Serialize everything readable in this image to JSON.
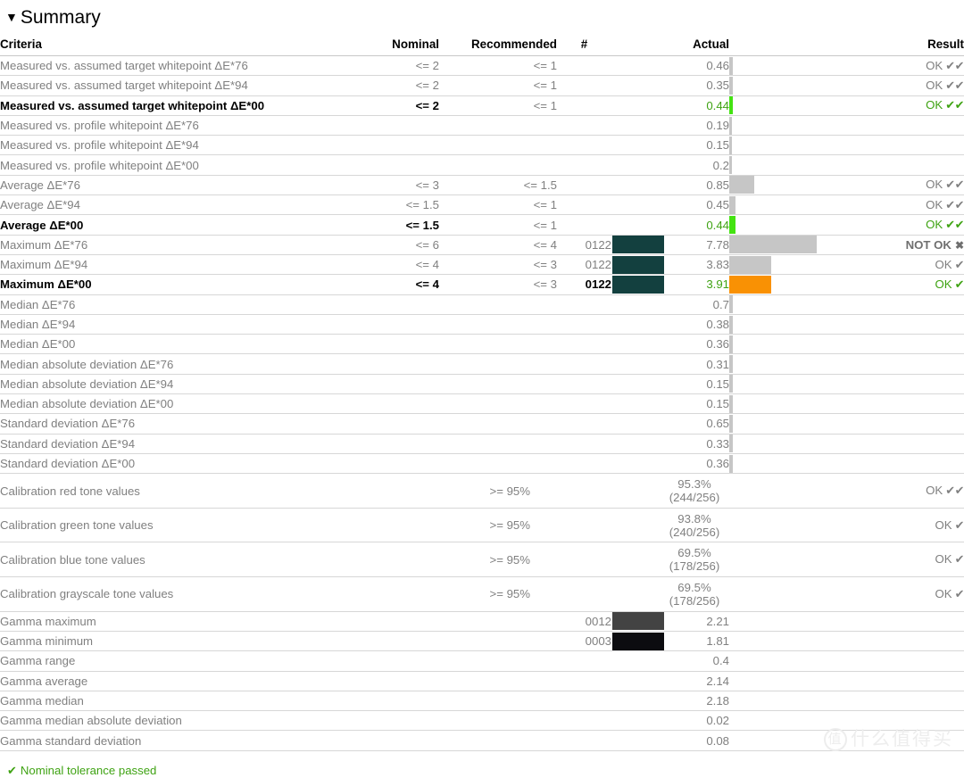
{
  "section": {
    "title": "Summary",
    "collapse_icon": "▼"
  },
  "table": {
    "headers": {
      "criteria": "Criteria",
      "nominal": "Nominal",
      "recommended": "Recommended",
      "number": "#",
      "swatch": "",
      "actual": "Actual",
      "bar": "",
      "result": "Result"
    },
    "rows": [
      {
        "criteria": "Measured vs. assumed target whitepoint ΔE*76",
        "nominal": "<= 2",
        "recommended": "<= 1",
        "number": "",
        "swatch": "",
        "actual": "0.46",
        "bar_pct": 2.4,
        "bar_color": "#c6c6c6",
        "result": "OK",
        "marks": "✔✔",
        "strong": false
      },
      {
        "criteria": "Measured vs. assumed target whitepoint ΔE*94",
        "nominal": "<= 2",
        "recommended": "<= 1",
        "number": "",
        "swatch": "",
        "actual": "0.35",
        "bar_pct": 2.4,
        "bar_color": "#c6c6c6",
        "result": "OK",
        "marks": "✔✔",
        "strong": false
      },
      {
        "criteria": "Measured vs. assumed target whitepoint ΔE*00",
        "nominal": "<= 2",
        "recommended": "<= 1",
        "number": "",
        "swatch": "",
        "actual": "0.44",
        "bar_pct": 2.4,
        "bar_color": "#44e312",
        "result": "OK",
        "marks": "✔✔",
        "strong": true
      },
      {
        "criteria": "Measured vs. profile whitepoint ΔE*76",
        "nominal": "",
        "recommended": "",
        "number": "",
        "swatch": "",
        "actual": "0.19",
        "bar_pct": 1.6,
        "bar_color": "#c6c6c6",
        "result": "",
        "marks": "",
        "strong": false
      },
      {
        "criteria": "Measured vs. profile whitepoint ΔE*94",
        "nominal": "",
        "recommended": "",
        "number": "",
        "swatch": "",
        "actual": "0.15",
        "bar_pct": 1.6,
        "bar_color": "#c6c6c6",
        "result": "",
        "marks": "",
        "strong": false
      },
      {
        "criteria": "Measured vs. profile whitepoint ΔE*00",
        "nominal": "",
        "recommended": "",
        "number": "",
        "swatch": "",
        "actual": "0.2",
        "bar_pct": 1.6,
        "bar_color": "#c6c6c6",
        "result": "",
        "marks": "",
        "strong": false
      },
      {
        "criteria": "Average ΔE*76",
        "nominal": "<= 3",
        "recommended": "<= 1.5",
        "number": "",
        "swatch": "",
        "actual": "0.85",
        "bar_pct": 15.0,
        "bar_color": "#c6c6c6",
        "result": "OK",
        "marks": "✔✔",
        "strong": false
      },
      {
        "criteria": "Average ΔE*94",
        "nominal": "<= 1.5",
        "recommended": "<= 1",
        "number": "",
        "swatch": "",
        "actual": "0.45",
        "bar_pct": 3.8,
        "bar_color": "#c6c6c6",
        "result": "OK",
        "marks": "✔✔",
        "strong": false
      },
      {
        "criteria": "Average ΔE*00",
        "nominal": "<= 1.5",
        "recommended": "<= 1",
        "number": "",
        "swatch": "",
        "actual": "0.44",
        "bar_pct": 3.8,
        "bar_color": "#44e312",
        "result": "OK",
        "marks": "✔✔",
        "strong": true
      },
      {
        "criteria": "Maximum ΔE*76",
        "nominal": "<= 6",
        "recommended": "<= 4",
        "number": "0122",
        "swatch": "#13403f",
        "actual": "7.78",
        "bar_pct": 52.5,
        "bar_color": "#c6c6c6",
        "result": "NOT OK",
        "marks": "✖",
        "strong": false,
        "notok": true
      },
      {
        "criteria": "Maximum ΔE*94",
        "nominal": "<= 4",
        "recommended": "<= 3",
        "number": "0122",
        "swatch": "#13403f",
        "actual": "3.83",
        "bar_pct": 25.3,
        "bar_color": "#c6c6c6",
        "result": "OK",
        "marks": "✔",
        "strong": false
      },
      {
        "criteria": "Maximum ΔE*00",
        "nominal": "<= 4",
        "recommended": "<= 3",
        "number": "0122",
        "swatch": "#13403f",
        "actual": "3.91",
        "bar_pct": 25.3,
        "bar_color": "#f99104",
        "result": "OK",
        "marks": "✔",
        "strong": true
      },
      {
        "criteria": "Median ΔE*76",
        "nominal": "",
        "recommended": "",
        "number": "",
        "swatch": "",
        "actual": "0.7",
        "bar_pct": 2.0,
        "bar_color": "#c6c6c6",
        "result": "",
        "marks": "",
        "strong": false
      },
      {
        "criteria": "Median ΔE*94",
        "nominal": "",
        "recommended": "",
        "number": "",
        "swatch": "",
        "actual": "0.38",
        "bar_pct": 2.0,
        "bar_color": "#c6c6c6",
        "result": "",
        "marks": "",
        "strong": false
      },
      {
        "criteria": "Median ΔE*00",
        "nominal": "",
        "recommended": "",
        "number": "",
        "swatch": "",
        "actual": "0.36",
        "bar_pct": 2.0,
        "bar_color": "#c6c6c6",
        "result": "",
        "marks": "",
        "strong": false
      },
      {
        "criteria": "Median absolute deviation ΔE*76",
        "nominal": "",
        "recommended": "",
        "number": "",
        "swatch": "",
        "actual": "0.31",
        "bar_pct": 2.0,
        "bar_color": "#c6c6c6",
        "result": "",
        "marks": "",
        "strong": false
      },
      {
        "criteria": "Median absolute deviation ΔE*94",
        "nominal": "",
        "recommended": "",
        "number": "",
        "swatch": "",
        "actual": "0.15",
        "bar_pct": 2.0,
        "bar_color": "#c6c6c6",
        "result": "",
        "marks": "",
        "strong": false
      },
      {
        "criteria": "Median absolute deviation ΔE*00",
        "nominal": "",
        "recommended": "",
        "number": "",
        "swatch": "",
        "actual": "0.15",
        "bar_pct": 2.0,
        "bar_color": "#c6c6c6",
        "result": "",
        "marks": "",
        "strong": false
      },
      {
        "criteria": "Standard deviation ΔE*76",
        "nominal": "",
        "recommended": "",
        "number": "",
        "swatch": "",
        "actual": "0.65",
        "bar_pct": 2.0,
        "bar_color": "#c6c6c6",
        "result": "",
        "marks": "",
        "strong": false
      },
      {
        "criteria": "Standard deviation ΔE*94",
        "nominal": "",
        "recommended": "",
        "number": "",
        "swatch": "",
        "actual": "0.33",
        "bar_pct": 2.0,
        "bar_color": "#c6c6c6",
        "result": "",
        "marks": "",
        "strong": false
      },
      {
        "criteria": "Standard deviation ΔE*00",
        "nominal": "",
        "recommended": "",
        "number": "",
        "swatch": "",
        "actual": "0.36",
        "bar_pct": 2.0,
        "bar_color": "#c6c6c6",
        "result": "",
        "marks": "",
        "strong": false
      }
    ],
    "tone_rows": [
      {
        "criteria": "Calibration red tone values",
        "recommended": ">= 95%",
        "actual_pct": "95.3%",
        "actual_ratio": "(244/256)",
        "result": "OK",
        "marks": "✔✔"
      },
      {
        "criteria": "Calibration green tone values",
        "recommended": ">= 95%",
        "actual_pct": "93.8%",
        "actual_ratio": "(240/256)",
        "result": "OK",
        "marks": "✔"
      },
      {
        "criteria": "Calibration blue tone values",
        "recommended": ">= 95%",
        "actual_pct": "69.5%",
        "actual_ratio": "(178/256)",
        "result": "OK",
        "marks": "✔"
      },
      {
        "criteria": "Calibration grayscale tone values",
        "recommended": ">= 95%",
        "actual_pct": "69.5%",
        "actual_ratio": "(178/256)",
        "result": "OK",
        "marks": "✔"
      }
    ],
    "gamma_rows": [
      {
        "criteria": "Gamma maximum",
        "number": "0012",
        "swatch": "#434343",
        "actual": "2.21"
      },
      {
        "criteria": "Gamma minimum",
        "number": "0003",
        "swatch": "#0c0c10",
        "actual": "1.81"
      },
      {
        "criteria": "Gamma range",
        "number": "",
        "swatch": "",
        "actual": "0.4"
      },
      {
        "criteria": "Gamma average",
        "number": "",
        "swatch": "",
        "actual": "2.14"
      },
      {
        "criteria": "Gamma median",
        "number": "",
        "swatch": "",
        "actual": "2.18"
      },
      {
        "criteria": "Gamma median absolute deviation",
        "number": "",
        "swatch": "",
        "actual": "0.02"
      },
      {
        "criteria": "Gamma standard deviation",
        "number": "",
        "swatch": "",
        "actual": "0.08"
      }
    ]
  },
  "footer": {
    "icon": "✔",
    "text": "Nominal tolerance passed"
  },
  "watermark": {
    "mark": "值",
    "text": "什么值得买"
  },
  "colors": {
    "pass_green": "#3fa313",
    "bar_green": "#44e312",
    "bar_orange": "#f99104",
    "bar_gray": "#c6c6c6",
    "text_gray": "#808080",
    "rule": "#d7d7d7"
  }
}
